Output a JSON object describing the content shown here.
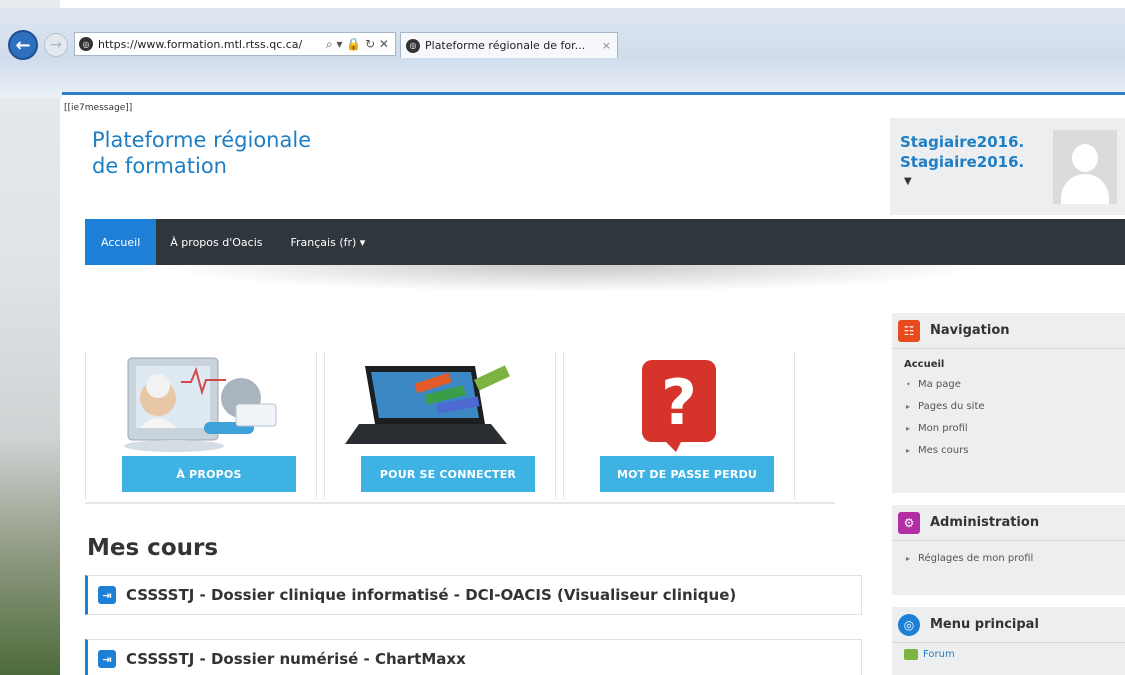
{
  "browser": {
    "address": "https://www.formation.mtl.rtss.qc.ca/",
    "address_icons": "⌕ ▾ 🔒 ↻ ✕",
    "tab_title": "Plateforme régionale de for...",
    "tab_close": "×"
  },
  "page": {
    "ie7message": "[[ie7message]]",
    "site_title_line1": "Plateforme régionale",
    "site_title_line2": "de formation",
    "user_line1": "Stagiaire2016.",
    "user_line2": "Stagiaire2016."
  },
  "navbar": {
    "items": [
      {
        "label": "Accueil"
      },
      {
        "label": "À propos d'Oacis"
      },
      {
        "label": "Français (fr) ▾"
      }
    ]
  },
  "tiles": [
    {
      "label": "À PROPOS",
      "icon": "monitor-doctor-image"
    },
    {
      "label": "POUR SE CONNECTER",
      "icon": "laptop-books-image"
    },
    {
      "label": "MOT DE PASSE PERDU",
      "icon": "question-mark-image"
    }
  ],
  "courses": {
    "title": "Mes cours",
    "items": [
      {
        "label": "CSSSSTJ - Dossier clinique informatisé - DCI-OACIS (Visualiseur clinique)"
      },
      {
        "label": "CSSSSTJ - Dossier numérisé - ChartMaxx"
      }
    ]
  },
  "blocks": {
    "navigation": {
      "title": "Navigation",
      "root": "Accueil",
      "items": [
        {
          "label": "Ma page",
          "bullet": "•"
        },
        {
          "label": "Pages du site",
          "bullet": "▸"
        },
        {
          "label": "Mon profil",
          "bullet": "▸"
        },
        {
          "label": "Mes cours",
          "bullet": "▸"
        }
      ]
    },
    "administration": {
      "title": "Administration",
      "items": [
        {
          "label": "Réglages de mon profil",
          "bullet": "▸"
        }
      ]
    },
    "main_menu": {
      "title": "Menu principal",
      "items": [
        {
          "label": "Forum"
        }
      ]
    }
  },
  "colors": {
    "link_blue": "#1f7fc4",
    "nav_dark": "#2f363c",
    "nav_active": "#1e7fd6",
    "tile_blue": "#3fb2e4",
    "nav_icon": "#e8491d",
    "admin_icon": "#b42da4",
    "menu_icon": "#1e7fd6"
  }
}
